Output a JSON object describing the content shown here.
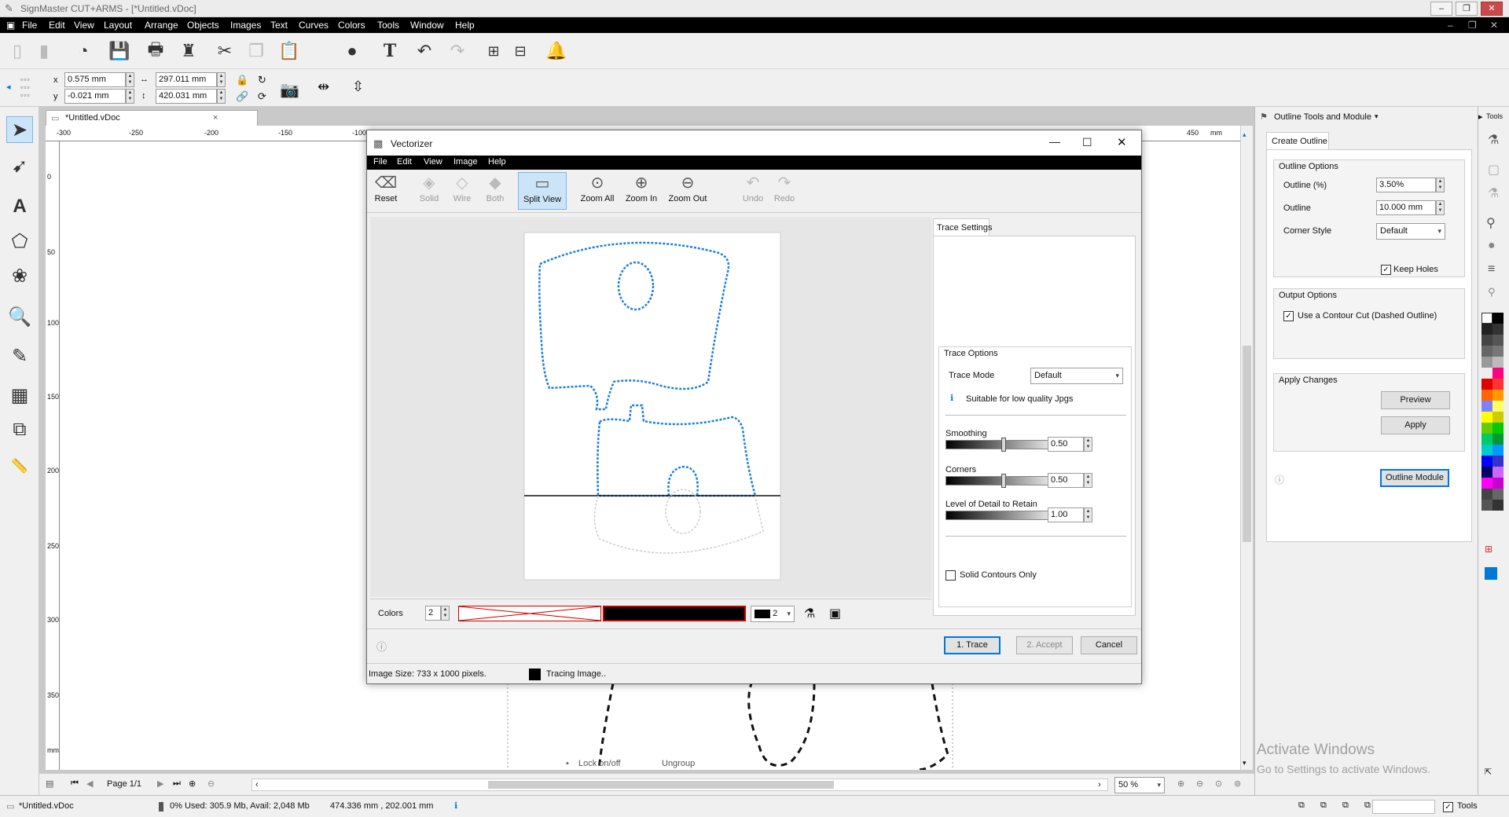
{
  "app": {
    "title": "SignMaster CUT+ARMS - [*Untitled.vDoc]",
    "menu": [
      "File",
      "Edit",
      "View",
      "Layout",
      "Arrange",
      "Objects",
      "Images",
      "Text",
      "Curves",
      "Colors",
      "Tools",
      "Window",
      "Help"
    ]
  },
  "propbar": {
    "x_label": "x",
    "x_value": "0.575 mm",
    "y_label": "y",
    "y_value": "-0.021 mm",
    "w_value": "297.011 mm",
    "h_value": "420.031 mm"
  },
  "document": {
    "tab": "*Untitled.vDoc",
    "ruler_h": [
      "-300",
      "-250",
      "-200",
      "-150",
      "-100",
      "450",
      "mm"
    ],
    "ruler_v": [
      "0",
      "50",
      "100",
      "150",
      "200",
      "250",
      "300",
      "350",
      "mm"
    ],
    "canvas_labels": [
      "Lock on/off",
      "Ungroup"
    ]
  },
  "vectorizer": {
    "title": "Vectorizer",
    "menu": [
      "File",
      "Edit",
      "View",
      "Image",
      "Help"
    ],
    "tools": [
      {
        "label": "Reset",
        "icon": "reset-icon"
      },
      {
        "label": "Solid",
        "icon": "solid-icon"
      },
      {
        "label": "Wire",
        "icon": "wire-icon"
      },
      {
        "label": "Both",
        "icon": "both-icon"
      },
      {
        "label": "Split View",
        "icon": "split-view-icon"
      },
      {
        "label": "Zoom All",
        "icon": "zoom-all-icon"
      },
      {
        "label": "Zoom In",
        "icon": "zoom-in-icon"
      },
      {
        "label": "Zoom Out",
        "icon": "zoom-out-icon"
      },
      {
        "label": "Undo",
        "icon": "undo-icon"
      },
      {
        "label": "Redo",
        "icon": "redo-icon"
      }
    ],
    "trace_settings_tab": "Trace Settings",
    "trace_options": {
      "group_label": "Trace Options",
      "trace_mode_label": "Trace Mode",
      "trace_mode_value": "Default",
      "hint": "Suitable for low quality Jpgs",
      "smoothing_label": "Smoothing",
      "smoothing_value": "0.50",
      "corners_label": "Corners",
      "corners_value": "0.50",
      "detail_label": "Level of Detail to Retain",
      "detail_value": "1.00",
      "solid_contours_label": "Solid Contours Only"
    },
    "colors_label": "Colors",
    "colors_value": "2",
    "color_swatch_count": "2",
    "buttons": {
      "trace": "1. Trace",
      "accept": "2. Accept",
      "cancel": "Cancel"
    },
    "status": {
      "image_size": "Image Size: 733 x 1000 pixels.",
      "tracing": "Tracing Image.."
    }
  },
  "outline_panel": {
    "title": "Outline Tools and Module",
    "tools_tab": "Tools",
    "tab": "Create Outline",
    "outline_options_label": "Outline Options",
    "outline_pct_label": "Outline (%)",
    "outline_pct_value": "3.50%",
    "outline_label": "Outline",
    "outline_value": "10.000 mm",
    "corner_style_label": "Corner Style",
    "corner_style_value": "Default",
    "keep_holes_label": "Keep Holes",
    "output_options_label": "Output Options",
    "contour_cut_label": "Use a Contour Cut (Dashed Outline)",
    "apply_changes_label": "Apply Changes",
    "preview_button": "Preview",
    "apply_button": "Apply",
    "outline_module_button": "Outline Module"
  },
  "bottombar": {
    "page": "Page 1/1",
    "zoom": "50 %"
  },
  "statusbar": {
    "doc": "*Untitled.vDoc",
    "memory": "0%   Used: 305.9 Mb, Avail: 2,048 Mb",
    "coords": "474.336 mm , 202.001 mm",
    "tools": "Tools"
  },
  "watermark": {
    "line1": "Activate Windows",
    "line2": "Go to Settings to activate Windows."
  },
  "colors": {
    "accent": "#0078d7",
    "trace_blue": "#1e7fd8"
  }
}
